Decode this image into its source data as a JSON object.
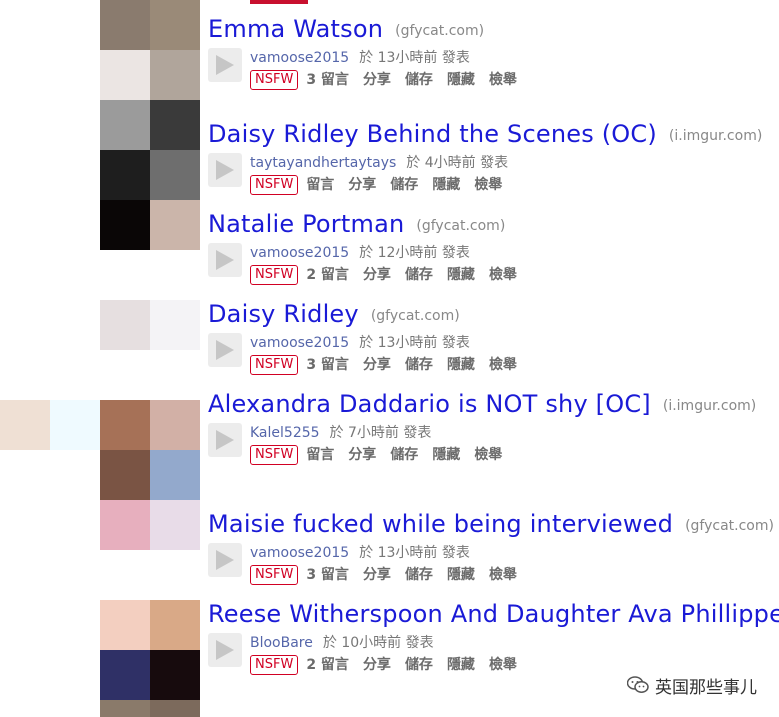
{
  "mosaic_colors": [
    "#8a7b6e",
    "#9a8a78",
    "#ebe5e3",
    "#b0a59b",
    "#9b9b9b",
    "#3a3a3a",
    "#1e1e1e",
    "#6e6e6e",
    "#0a0606",
    "#cbb5aa",
    "#e6dfe0",
    "#f4f3f6",
    "#efe0d4",
    "#effaff",
    "#a67157",
    "#d2b0a6",
    "#7a5444",
    "#93a9cc",
    "#e7afbe",
    "#e8dce8",
    "#f3cfc0",
    "#d9a987",
    "#2f3066",
    "#170b0d",
    "#8a7a6a",
    "#7c6a5c",
    "#c8102e"
  ],
  "posts": [
    {
      "title": "Emma Watson",
      "domain": "(gfycat.com)",
      "author": "vamoose2015",
      "ago": "於 13小時前 發表",
      "nsfw": "NSFW",
      "comments": "3 留言",
      "share": "分享",
      "save": "儲存",
      "hide": "隱藏",
      "report": "檢舉"
    },
    {
      "title": "Daisy Ridley Behind the Scenes (OC)",
      "domain": "(i.imgur.com)",
      "author": "taytayandhertaytays",
      "ago": "於 4小時前 發表",
      "nsfw": "NSFW",
      "comments": "留言",
      "share": "分享",
      "save": "儲存",
      "hide": "隱藏",
      "report": "檢舉"
    },
    {
      "title": "Natalie Portman",
      "domain": "(gfycat.com)",
      "author": "vamoose2015",
      "ago": "於 12小時前 發表",
      "nsfw": "NSFW",
      "comments": "2 留言",
      "share": "分享",
      "save": "儲存",
      "hide": "隱藏",
      "report": "檢舉"
    },
    {
      "title": "Daisy Ridley",
      "domain": "(gfycat.com)",
      "author": "vamoose2015",
      "ago": "於 13小時前 發表",
      "nsfw": "NSFW",
      "comments": "3 留言",
      "share": "分享",
      "save": "儲存",
      "hide": "隱藏",
      "report": "檢舉"
    },
    {
      "title": "Alexandra Daddario is NOT shy [OC]",
      "domain": "(i.imgur.com)",
      "author": "Kalel5255",
      "ago": "於 7小時前 發表",
      "nsfw": "NSFW",
      "comments": "留言",
      "share": "分享",
      "save": "儲存",
      "hide": "隱藏",
      "report": "檢舉"
    },
    {
      "title": "Maisie fucked while being interviewed",
      "domain": "(gfycat.com)",
      "author": "vamoose2015",
      "ago": "於 13小時前 發表",
      "nsfw": "NSFW",
      "comments": "3 留言",
      "share": "分享",
      "save": "儲存",
      "hide": "隱藏",
      "report": "檢舉"
    },
    {
      "title": "Reese Witherspoon And Daughter Ava Phillippe",
      "domain": "",
      "author": "BlooBare",
      "ago": "於 10小時前 發表",
      "nsfw": "NSFW",
      "comments": "2 留言",
      "share": "分享",
      "save": "儲存",
      "hide": "隱藏",
      "report": "檢舉"
    }
  ],
  "watermark": {
    "text": "英国那些事儿",
    "icon": "wechat-icon"
  },
  "colors": {
    "title": "#1a1ad6",
    "nsfw": "#d10023",
    "meta": "#666666"
  }
}
